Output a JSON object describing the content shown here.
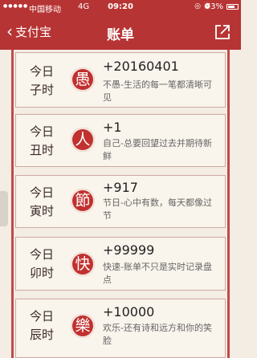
{
  "status": {
    "carrier": "中国移动",
    "network": "4G",
    "time": "09:20",
    "icons": "◎ ⏰",
    "battery_percent": "73%",
    "battery_level": 0.73
  },
  "nav": {
    "back_label": "支付宝",
    "title": "账单"
  },
  "entries": [
    {
      "period": [
        "今日",
        "子时"
      ],
      "seal": "愚",
      "amount": "+20160401",
      "desc": "不愚-生活的每一笔都清晰可见"
    },
    {
      "period": [
        "今日",
        "丑时"
      ],
      "seal": "人",
      "amount": "+1",
      "desc": "自己-总要回望过去并期待新鲜"
    },
    {
      "period": [
        "今日",
        "寅时"
      ],
      "seal": "節",
      "amount": "+917",
      "desc": "节日-心中有数，每天都像过节"
    },
    {
      "period": [
        "今日",
        "卯时"
      ],
      "seal": "快",
      "amount": "+99999",
      "desc": "快速-账单不只是实时记录盘点"
    },
    {
      "period": [
        "今日",
        "辰时"
      ],
      "seal": "樂",
      "amount": "+10000",
      "desc": "欢乐-还有诗和远方和你的笑脸"
    }
  ]
}
